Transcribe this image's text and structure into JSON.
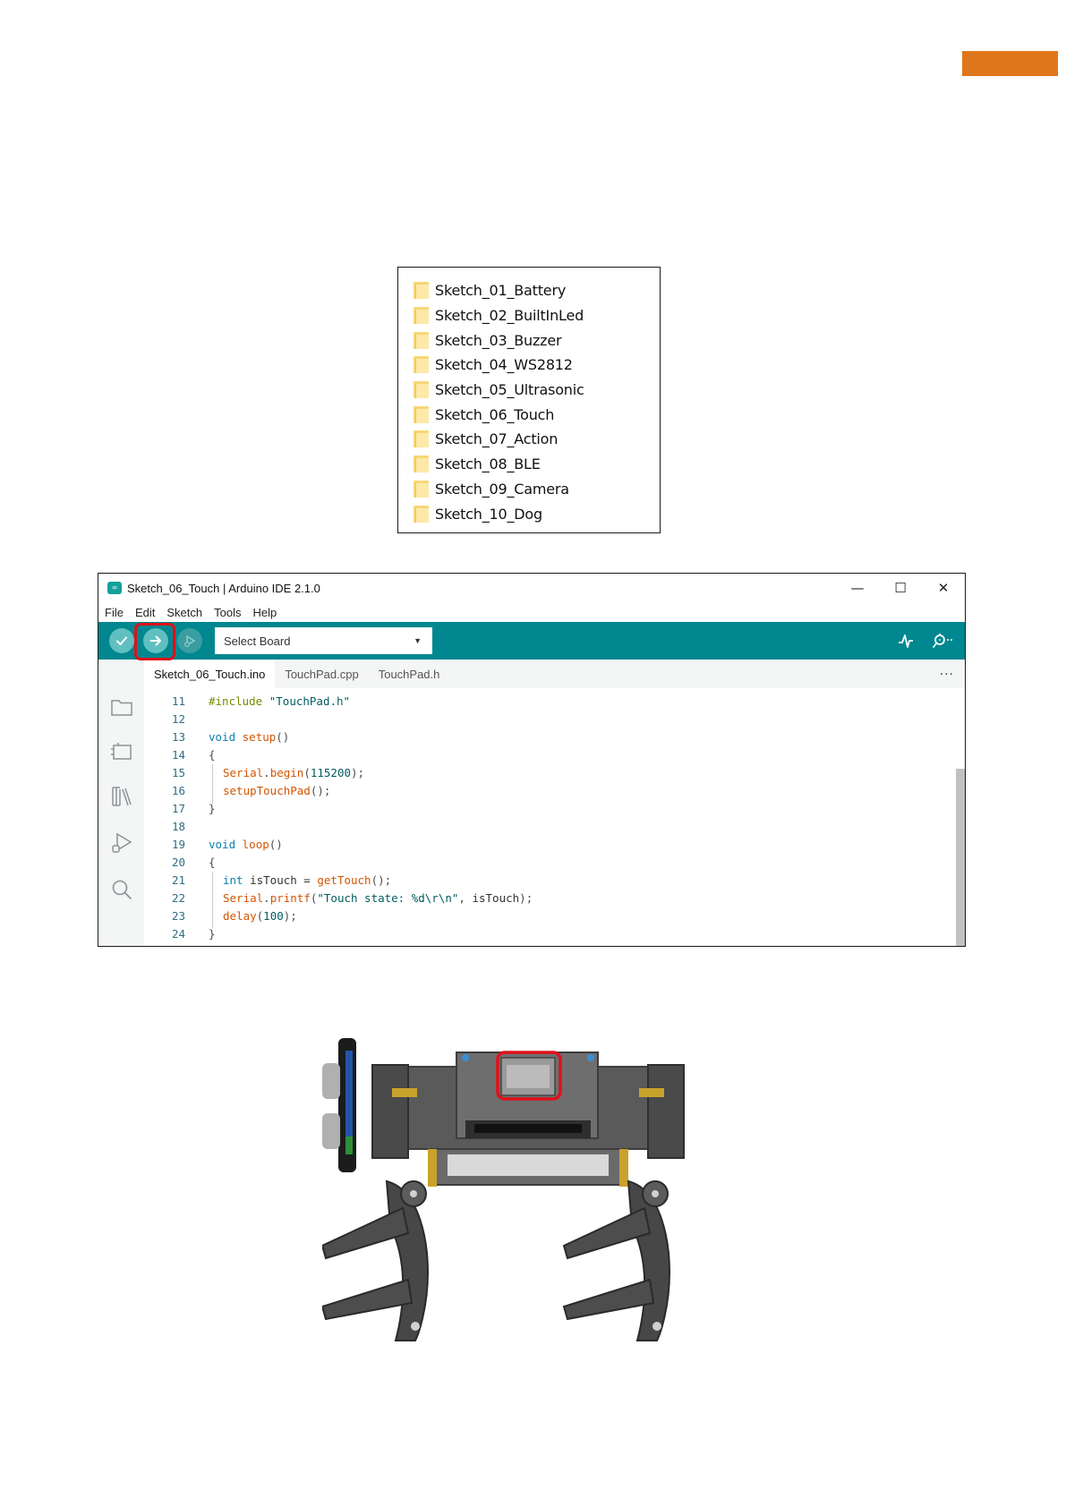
{
  "folders": [
    "Sketch_01_Battery",
    "Sketch_02_BuiltInLed",
    "Sketch_03_Buzzer",
    "Sketch_04_WS2812",
    "Sketch_05_Ultrasonic",
    "Sketch_06_Touch",
    "Sketch_07_Action",
    "Sketch_08_BLE",
    "Sketch_09_Camera",
    "Sketch_10_Dog"
  ],
  "ide": {
    "title": "Sketch_06_Touch | Arduino IDE 2.1.0",
    "logo_text": "∞",
    "window_controls": {
      "minimize": "—",
      "maximize": "☐",
      "close": "✕"
    },
    "menu": [
      "File",
      "Edit",
      "Sketch",
      "Tools",
      "Help"
    ],
    "board_select": "Select Board",
    "tabs": [
      "Sketch_06_Touch.ino",
      "TouchPad.cpp",
      "TouchPad.h"
    ],
    "tab_more": "···",
    "code_lines": [
      {
        "n": "11",
        "tokens": [
          [
            "pp",
            "#include"
          ],
          [
            "",
            " "
          ],
          [
            "str",
            "\"TouchPad.h\""
          ]
        ]
      },
      {
        "n": "12",
        "tokens": []
      },
      {
        "n": "13",
        "tokens": [
          [
            "kw",
            "void"
          ],
          [
            "",
            " "
          ],
          [
            "fn",
            "setup"
          ],
          [
            "punc",
            "()"
          ]
        ]
      },
      {
        "n": "14",
        "tokens": [
          [
            "punc",
            "{"
          ]
        ]
      },
      {
        "n": "15",
        "indent": true,
        "tokens": [
          [
            "fn",
            "Serial"
          ],
          [
            "punc",
            "."
          ],
          [
            "fn",
            "begin"
          ],
          [
            "punc",
            "("
          ],
          [
            "num",
            "115200"
          ],
          [
            "punc",
            ");"
          ]
        ]
      },
      {
        "n": "16",
        "indent": true,
        "tokens": [
          [
            "fn",
            "setupTouchPad"
          ],
          [
            "punc",
            "();"
          ]
        ]
      },
      {
        "n": "17",
        "tokens": [
          [
            "punc",
            "}"
          ]
        ]
      },
      {
        "n": "18",
        "tokens": []
      },
      {
        "n": "19",
        "tokens": [
          [
            "kw",
            "void"
          ],
          [
            "",
            " "
          ],
          [
            "fn",
            "loop"
          ],
          [
            "punc",
            "()"
          ]
        ]
      },
      {
        "n": "20",
        "tokens": [
          [
            "punc",
            "{"
          ]
        ]
      },
      {
        "n": "21",
        "indent": true,
        "tokens": [
          [
            "kw",
            "int"
          ],
          [
            "",
            " isTouch = "
          ],
          [
            "fn",
            "getTouch"
          ],
          [
            "punc",
            "();"
          ]
        ]
      },
      {
        "n": "22",
        "indent": true,
        "tokens": [
          [
            "fn",
            "Serial"
          ],
          [
            "punc",
            "."
          ],
          [
            "fn",
            "printf"
          ],
          [
            "punc",
            "("
          ],
          [
            "str",
            "\"Touch state: %d\\r\\n\""
          ],
          [
            "punc",
            ", "
          ],
          [
            "",
            "isTouch"
          ],
          [
            "punc",
            ");"
          ]
        ]
      },
      {
        "n": "23",
        "indent": true,
        "tokens": [
          [
            "fn",
            "delay"
          ],
          [
            "punc",
            "("
          ],
          [
            "num",
            "100"
          ],
          [
            "punc",
            ");"
          ]
        ]
      },
      {
        "n": "24",
        "tokens": [
          [
            "punc",
            "}"
          ]
        ]
      }
    ]
  },
  "colors": {
    "accent_orange": "#e0761c",
    "toolbar_teal": "#00878f",
    "highlight_red": "#e0101a"
  }
}
